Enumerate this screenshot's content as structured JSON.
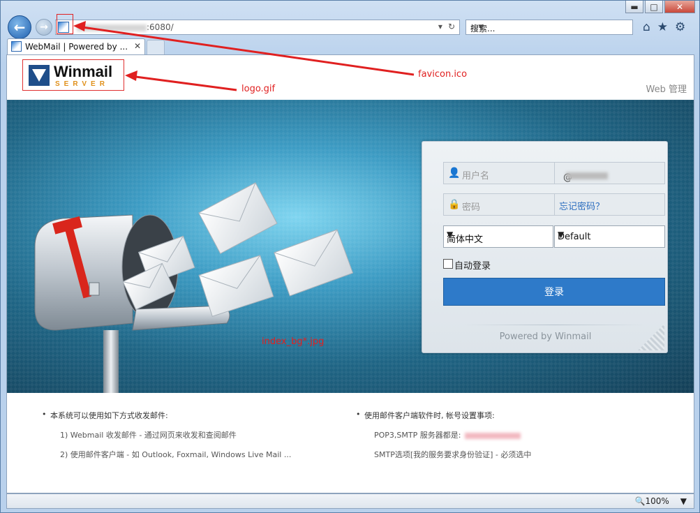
{
  "window": {
    "controls": {
      "minimize": "▬",
      "maximize": "□",
      "close": "✕"
    }
  },
  "browser": {
    "url_suffix": ":6080/",
    "search_placeholder": "搜索...",
    "tab_title": "WebMail | Powered by ...",
    "tab_close": "✕",
    "zoom_level": "100%"
  },
  "header": {
    "logo_title": "Winmail",
    "logo_subtitle": "SERVER",
    "web_admin_link": "Web 管理"
  },
  "login": {
    "username_label": "用户名",
    "username_suffix": "@",
    "password_label": "密码",
    "forgot_password_link": "忘记密码？",
    "language_selected": "简体中文",
    "skin_selected": "Default",
    "auto_login_label": "自动登录",
    "login_button": "登录",
    "powered_by": "Powered by Winmail"
  },
  "info": {
    "left_title": "本系统可以使用如下方式收发邮件:",
    "left_lines": [
      "1) Webmail 收发邮件 - 通过网页来收发和查阅邮件",
      "2) 使用邮件客户端 - 如 Outlook, Foxmail, Windows Live Mail ..."
    ],
    "right_title": "使用邮件客户端软件时, 帐号设置事项:",
    "right_lines": [
      "POP3,SMTP 服务器都是:",
      "SMTP选项[我的服务要求身份验证] - 必须选中"
    ]
  },
  "annotations": {
    "favicon": "favicon.ico",
    "logo": "logo.gif",
    "background": "index_bg*.jpg"
  },
  "colors": {
    "accent_blue": "#2e7ac9",
    "annotation_red": "#e02020",
    "banner_dark": "#133e56",
    "banner_light": "#7fd5f0"
  }
}
